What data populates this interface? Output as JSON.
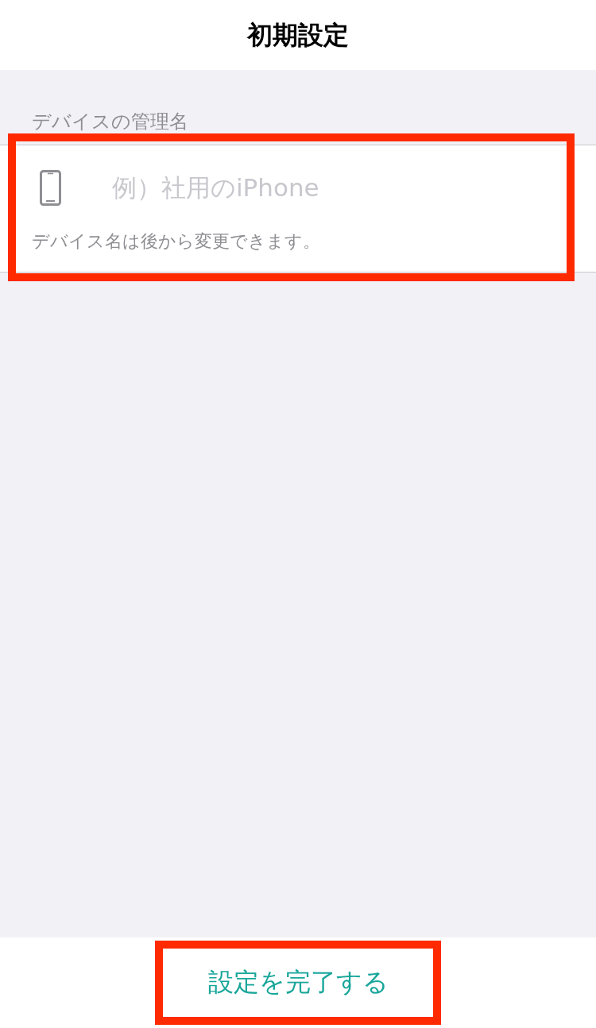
{
  "header": {
    "title": "初期設定"
  },
  "device_name_section": {
    "label": "デバイスの管理名",
    "placeholder": "例）社用のiPhone",
    "hint": "デバイス名は後から変更できます。",
    "highlighted": true
  },
  "footer": {
    "complete_button": {
      "label": "設定を完了する",
      "highlighted": true
    }
  }
}
